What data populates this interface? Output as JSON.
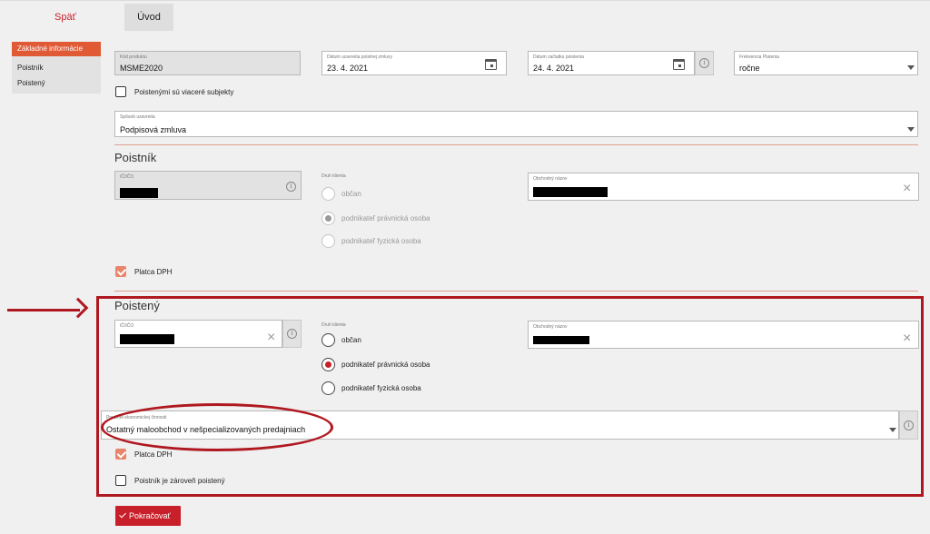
{
  "nav": {
    "back_label": "Späť",
    "tab_label": "Úvod"
  },
  "sidebar": {
    "items": [
      {
        "label": "Základné informácie",
        "active": true
      },
      {
        "label": "Poistník",
        "active": false
      },
      {
        "label": "Poistený",
        "active": false
      }
    ]
  },
  "general": {
    "product_code": {
      "label": "Kód produktu",
      "value": "MSME2020"
    },
    "contract_date": {
      "label": "Dátum uzavretia poistnej zmluvy",
      "value": "23. 4. 2021",
      "icon": "calendar-icon"
    },
    "start_date": {
      "label": "Dátum začiatku poistenia",
      "value": "24. 4. 2021",
      "icon": "calendar-icon"
    },
    "payment_frequency": {
      "label": "Frekvencia Platenia",
      "value": "ročne"
    },
    "multiple_subjects_label": "Poistenými sú viaceré subjekty",
    "conclusion_method": {
      "label": "Spôsob uzavretia",
      "value": "Podpisová zmluva"
    }
  },
  "policyholder": {
    "title": "Poistník",
    "id_label": "IČ/IČO",
    "type_label": "Druh klienta",
    "name_label": "Obchodný názov",
    "types": [
      {
        "label": "občan",
        "selected": false
      },
      {
        "label": "podnikateľ právnická osoba",
        "selected": true
      },
      {
        "label": "podnikateľ fyzická osoba",
        "selected": false
      }
    ],
    "vat_payer_label": "Platca DPH"
  },
  "insured": {
    "title": "Poistený",
    "id_label": "IČ/IČO",
    "type_label": "Druh klienta",
    "name_label": "Obchodný názov",
    "types": [
      {
        "label": "občan",
        "selected": false
      },
      {
        "label": "podnikateľ právnická osoba",
        "selected": true
      },
      {
        "label": "podnikateľ fyzická osoba",
        "selected": false
      }
    ],
    "activity": {
      "label": "Predmet ekonomickej činnosti",
      "value": "Ostatný maloobchod v nešpecializovaných predajniach"
    },
    "vat_payer_label": "Platca DPH",
    "same_as_holder_label": "Poistník je zároveň poistený"
  },
  "actions": {
    "continue_label": "Pokračovať"
  },
  "colors": {
    "accent": "#c8202a",
    "sidebar_active": "#e05a36",
    "annotation": "#b01820"
  }
}
